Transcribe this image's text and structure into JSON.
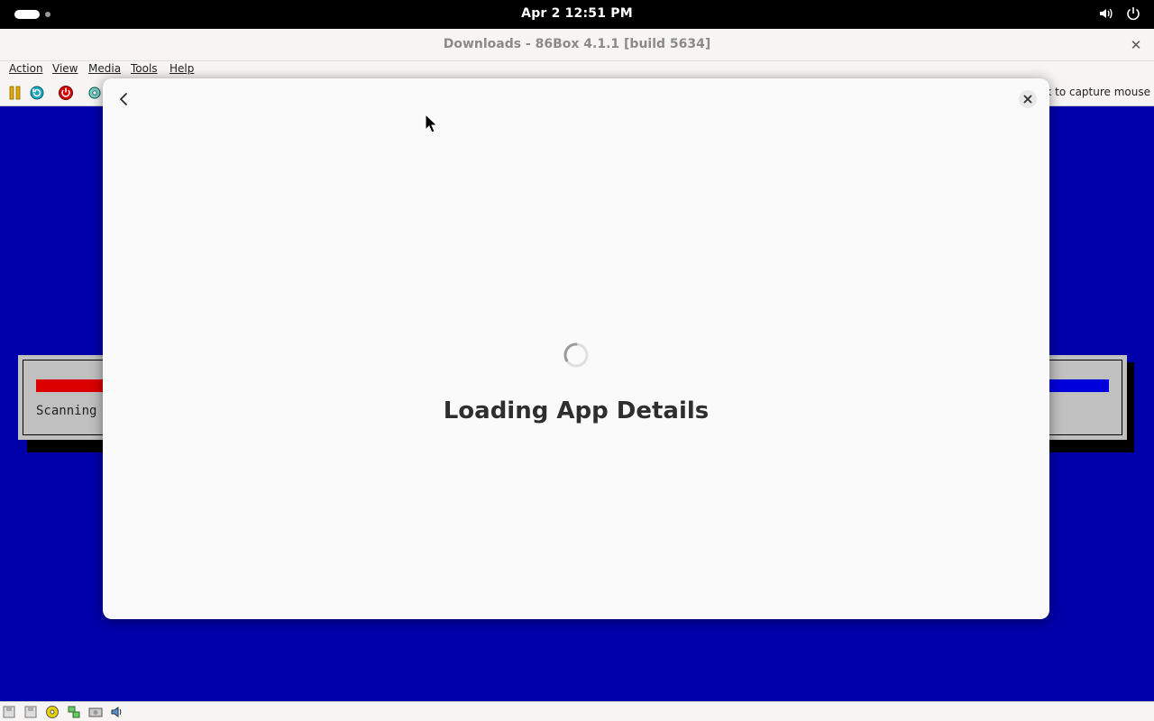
{
  "topbar": {
    "clock": "Apr 2  12:51 PM",
    "icons": [
      "activities-indicator",
      "volume-icon",
      "power-icon"
    ]
  },
  "window": {
    "title": "Downloads - 86Box 4.1.1 [build 5634]",
    "close_icon": "close-icon"
  },
  "menubar": {
    "items": [
      {
        "label": "Action"
      },
      {
        "label": "View"
      },
      {
        "label": "Media"
      },
      {
        "label": "Tools"
      },
      {
        "label": "Help"
      }
    ]
  },
  "toolbar": {
    "icons": [
      "pause-icon",
      "reset-icon",
      "power-off-icon",
      "settings-icon"
    ],
    "capture_hint": "lick to capture mouse"
  },
  "vm_screen": {
    "text": "Scanning",
    "colors": {
      "background": "#0000aa",
      "progress_red": "#dd0000",
      "progress_blue": "#0000dd",
      "panel": "#c0c0c0"
    }
  },
  "statusbar": {
    "icons": [
      "floppy-icon",
      "floppy-icon",
      "cdrom-icon",
      "network-icon",
      "hdd-icon",
      "sound-icon"
    ]
  },
  "dialog": {
    "loading_title": "Loading App Details",
    "back_icon": "chevron-left-icon",
    "close_icon": "close-icon",
    "spinner_icon": "spinner-icon"
  }
}
